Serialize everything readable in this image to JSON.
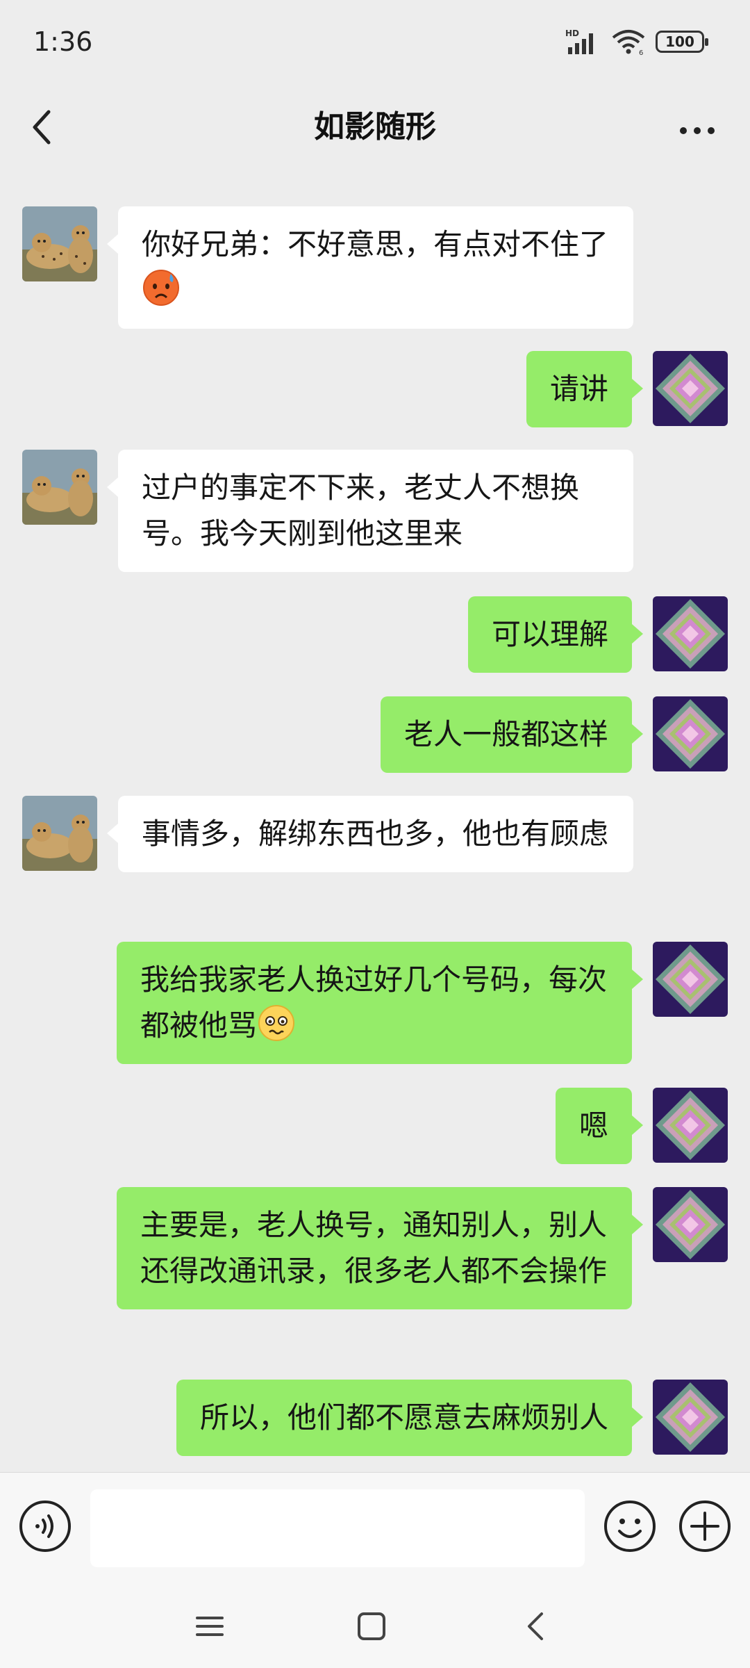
{
  "status_bar": {
    "time": "1:36",
    "battery": "100",
    "icons": [
      "hd-signal-icon",
      "wifi-icon",
      "battery-icon"
    ]
  },
  "header": {
    "title": "如影随形",
    "back_icon": "chevron-left-icon",
    "more_icon": "more-dots-icon"
  },
  "messages": [
    {
      "side": "in",
      "text": "你好兄弟：不好意思，有点对不住了",
      "emoji": "anxious-sweat-emoji"
    },
    {
      "side": "out",
      "text": "请讲"
    },
    {
      "side": "in",
      "text": "过户的事定不下来，老丈人不想换号。我今天刚到他这里来"
    },
    {
      "side": "out",
      "text": "可以理解"
    },
    {
      "side": "out",
      "text": "老人一般都这样"
    },
    {
      "side": "in",
      "text": "事情多，解绑东西也多，他也有顾虑"
    },
    {
      "side": "out",
      "text": "我给我家老人换过好几个号码，每次都被他骂",
      "emoji": "pleading-face-emoji"
    },
    {
      "side": "out",
      "text": "嗯"
    },
    {
      "side": "out",
      "text": "主要是，老人换号，通知别人，别人还得改通讯录，很多老人都不会操作"
    },
    {
      "side": "out",
      "text": "所以，他们都不愿意去麻烦别人"
    }
  ],
  "input_bar": {
    "value": "",
    "voice_icon": "voice-icon",
    "emoji_icon": "smiley-icon",
    "plus_icon": "plus-circle-icon"
  },
  "nav_bar": {
    "icons": [
      "menu-icon",
      "home-square-icon",
      "back-chevron-icon"
    ]
  },
  "colors": {
    "background": "#ededed",
    "outgoing_bubble": "#95ec69",
    "incoming_bubble": "#ffffff"
  }
}
